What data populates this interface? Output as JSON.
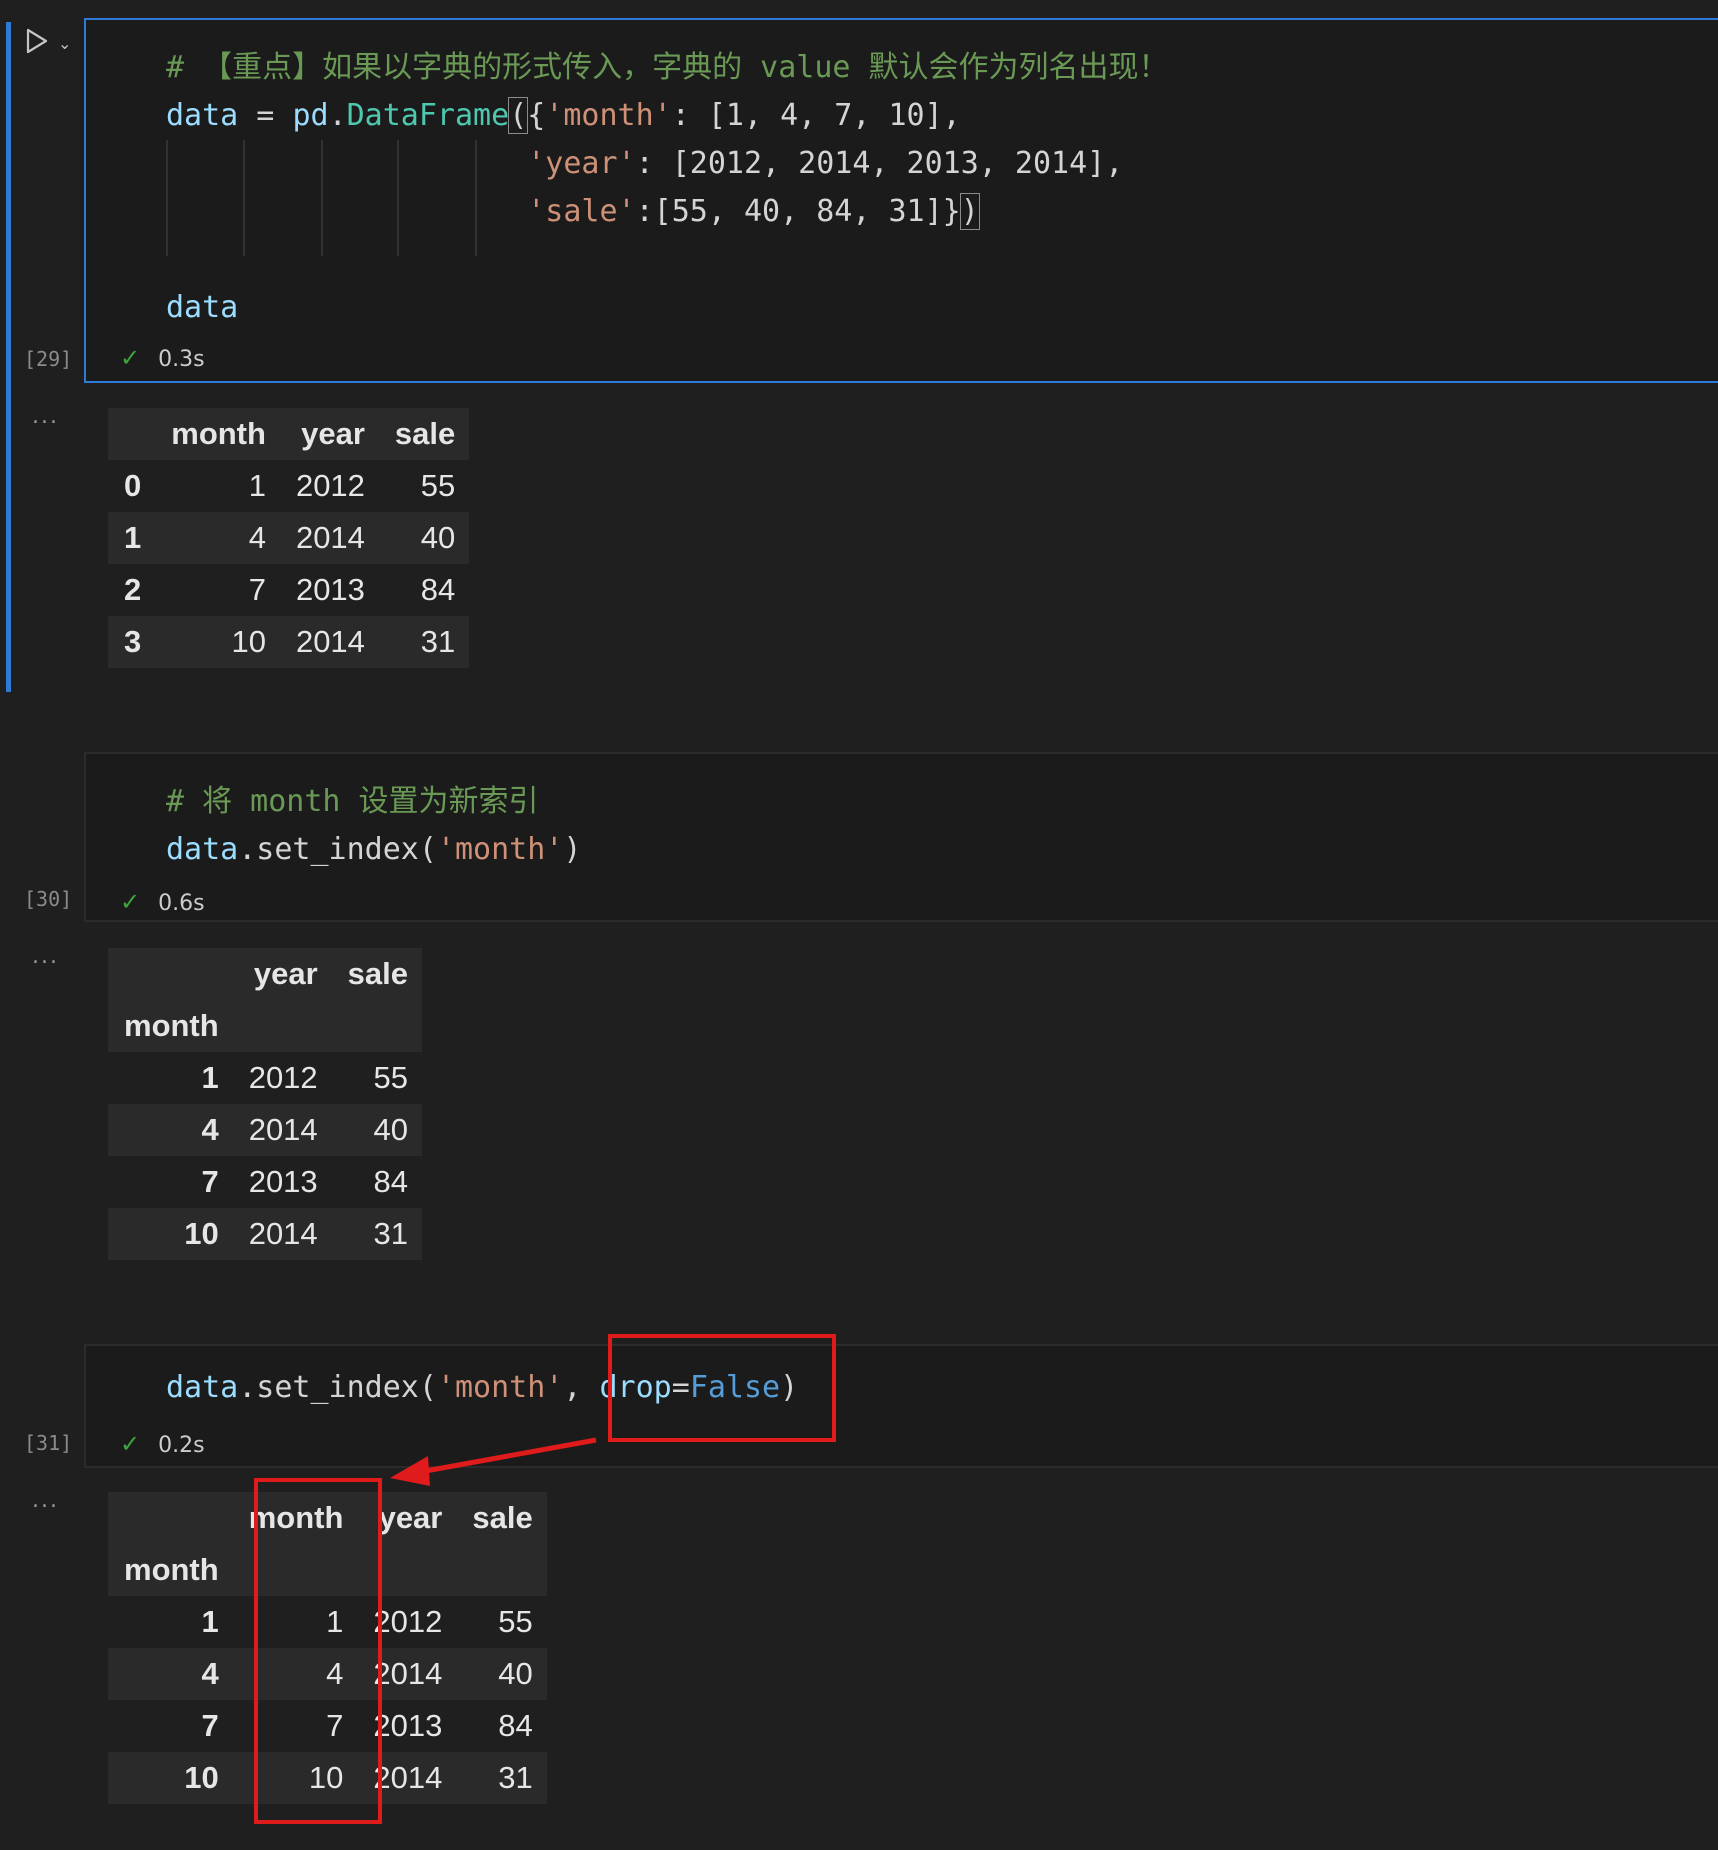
{
  "cells": [
    {
      "exec_count": "[29]",
      "duration": "0.3s",
      "code": {
        "comment": "# 【重点】如果以字典的形式传入，字典的 value 默认会作为列名出现！",
        "l1_var": "data",
        "l1_eq": " = ",
        "l1_mod": "pd",
        "l1_dot": ".",
        "l1_func": "DataFrame",
        "l1_open": "(",
        "l1_brace": "{",
        "l1_key": "'month'",
        "l1_vals": ": [1, 4, 7, 10],",
        "l2_key": "'year'",
        "l2_vals": ": [2012, 2014, 2013, 2014],",
        "l3_key": "'sale'",
        "l3_vals": ":[55, 40, 84, 31]}",
        "l3_close": ")",
        "last": "data"
      },
      "output": {
        "columns": [
          "",
          "month",
          "year",
          "sale"
        ],
        "rows": [
          [
            "0",
            "1",
            "2012",
            "55"
          ],
          [
            "1",
            "4",
            "2014",
            "40"
          ],
          [
            "2",
            "7",
            "2013",
            "84"
          ],
          [
            "3",
            "10",
            "2014",
            "31"
          ]
        ]
      }
    },
    {
      "exec_count": "[30]",
      "duration": "0.6s",
      "code": {
        "comment": "# 将 month 设置为新索引",
        "var": "data",
        "method": ".set_index(",
        "arg": "'month'",
        "close": ")"
      },
      "output": {
        "columns": [
          "",
          "year",
          "sale"
        ],
        "index_name": "month",
        "rows": [
          [
            "1",
            "2012",
            "55"
          ],
          [
            "4",
            "2014",
            "40"
          ],
          [
            "7",
            "2013",
            "84"
          ],
          [
            "10",
            "2014",
            "31"
          ]
        ]
      }
    },
    {
      "exec_count": "[31]",
      "duration": "0.2s",
      "code": {
        "var": "data",
        "method": ".set_index(",
        "arg": "'month'",
        "sep": ", ",
        "kw": "drop",
        "eq": "=",
        "val": "False",
        "close": ")"
      },
      "output": {
        "columns": [
          "",
          "month",
          "year",
          "sale"
        ],
        "index_name": "month",
        "rows": [
          [
            "1",
            "1",
            "2012",
            "55"
          ],
          [
            "4",
            "4",
            "2014",
            "40"
          ],
          [
            "7",
            "7",
            "2013",
            "84"
          ],
          [
            "10",
            "10",
            "2014",
            "31"
          ]
        ]
      }
    }
  ],
  "ui": {
    "check_glyph": "✓",
    "output_dots": "...",
    "chevron": "⌄"
  },
  "colors": {
    "background": "#1f1f1f",
    "focus_accent": "#2d7bd6",
    "annotation_red": "#e01b1b",
    "success_green": "#3fa33f"
  }
}
